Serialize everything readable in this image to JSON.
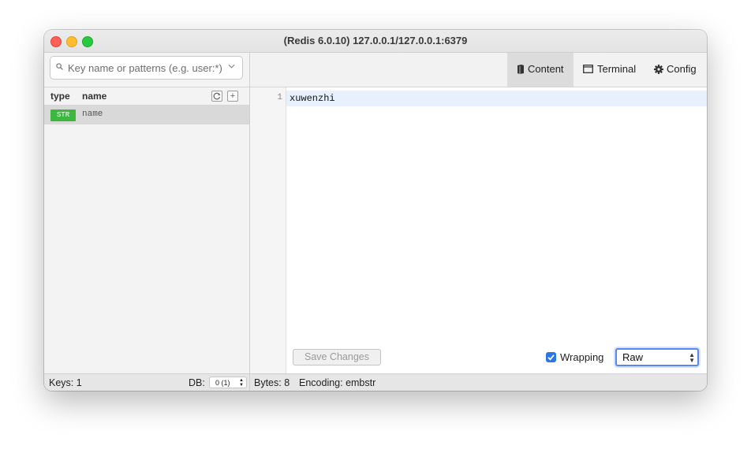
{
  "window": {
    "title": "(Redis 6.0.10) 127.0.0.1/127.0.0.1:6379"
  },
  "search": {
    "placeholder": "Key name or patterns (e.g. user:*)",
    "value": ""
  },
  "key_list": {
    "columns": {
      "type": "type",
      "name": "name"
    },
    "refresh_icon": "refresh-icon",
    "add_icon": "+",
    "rows": [
      {
        "type": "STR",
        "name": "name",
        "selected": true
      }
    ],
    "type_color": "#3cb83f"
  },
  "tabs": [
    {
      "label": "Content",
      "icon": "book-icon",
      "active": true
    },
    {
      "label": "Terminal",
      "icon": "window-icon",
      "active": false
    },
    {
      "label": "Config",
      "icon": "gear-icon",
      "active": false
    }
  ],
  "editor": {
    "lines": [
      {
        "number": "1",
        "text": "xuwenzhi"
      }
    ],
    "save_label": "Save Changes",
    "wrapping_label": "Wrapping",
    "wrapping_checked": true,
    "format_selected": "Raw"
  },
  "status": {
    "keys": "Keys: 1",
    "db_label": "DB:",
    "db_value": "0 (1)",
    "bytes": "Bytes: 8",
    "encoding": "Encoding: embstr"
  },
  "colors": {
    "accent": "#2d75e8",
    "active_line": "#e7f0fd",
    "select_focus": "#5b86f0"
  }
}
